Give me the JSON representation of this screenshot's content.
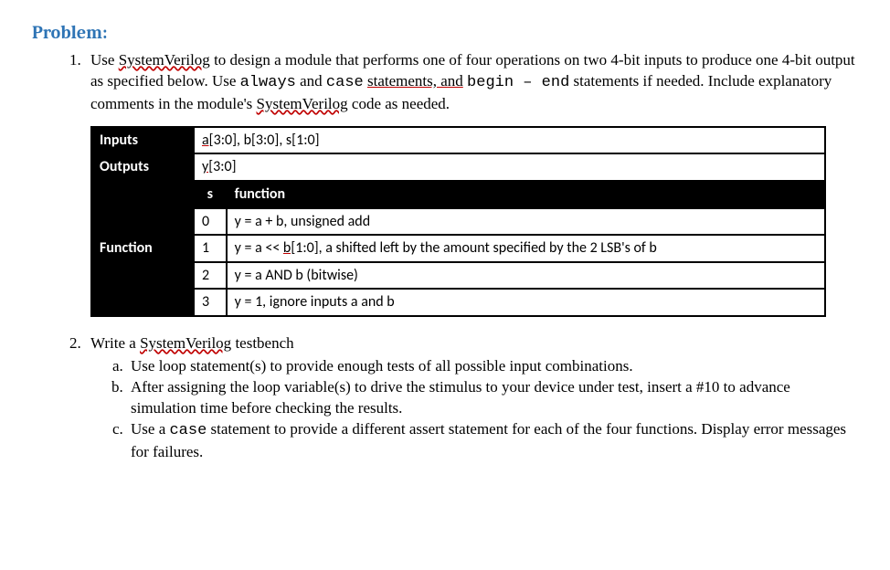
{
  "heading": "Problem:",
  "item1": {
    "pre1": "Use ",
    "sv": "SystemVerilog",
    "post1": " to design a module that performs one of four operations on two 4-bit inputs to produce one 4-bit output as specified below. Use ",
    "always": "always",
    "and1": " and ",
    "case": "case",
    "nl1": " ",
    "stmts_and": "statements, and",
    "sp1": " ",
    "begin": "begin",
    "dash": " – ",
    "end": "end",
    "post2": " statements if needed. Include explanatory comments in the module's ",
    "sv2": "SystemVerilog",
    "post3": " code as needed."
  },
  "table": {
    "row_inputs_label": "Inputs",
    "row_inputs_val_pre": "a[",
    "row_inputs_val_a": "a[3:0]",
    "row_inputs_comma": ", b[3:0], s[1:0]",
    "row_inputs_a_underline": "a[",
    "row_outputs_label": "Outputs",
    "row_outputs_val_pre": "y[",
    "row_outputs_val": "y[3:0]",
    "row_outputs_underline": "y[",
    "row_function_label": "Function",
    "head_s": "s",
    "head_fn": "function",
    "rows": [
      {
        "s": "0",
        "fn": "y = a + b, unsigned add"
      },
      {
        "s": "1",
        "fn_pre": "y = a << ",
        "fn_u": "b[",
        "fn_u_text": "b[",
        "fn_mid": "1:0], a shifted left by the amount specified by the 2 LSB's of b"
      },
      {
        "s": "2",
        "fn": "y = a AND b (bitwise)"
      },
      {
        "s": "3",
        "fn": "y = 1, ignore inputs a and b"
      }
    ]
  },
  "item2": {
    "pre": "Write a ",
    "sv": "SystemVerilog",
    "post": " testbench",
    "a": "Use loop statement(s) to provide enough tests of all possible input combinations.",
    "b": "After assigning the loop variable(s) to drive the stimulus to your device under test, insert a #10 to advance simulation time before checking the results.",
    "c_pre": "Use a ",
    "c_case": "case",
    "c_post": " statement to provide a different assert statement for each of the four functions.  Display error messages for failures."
  }
}
